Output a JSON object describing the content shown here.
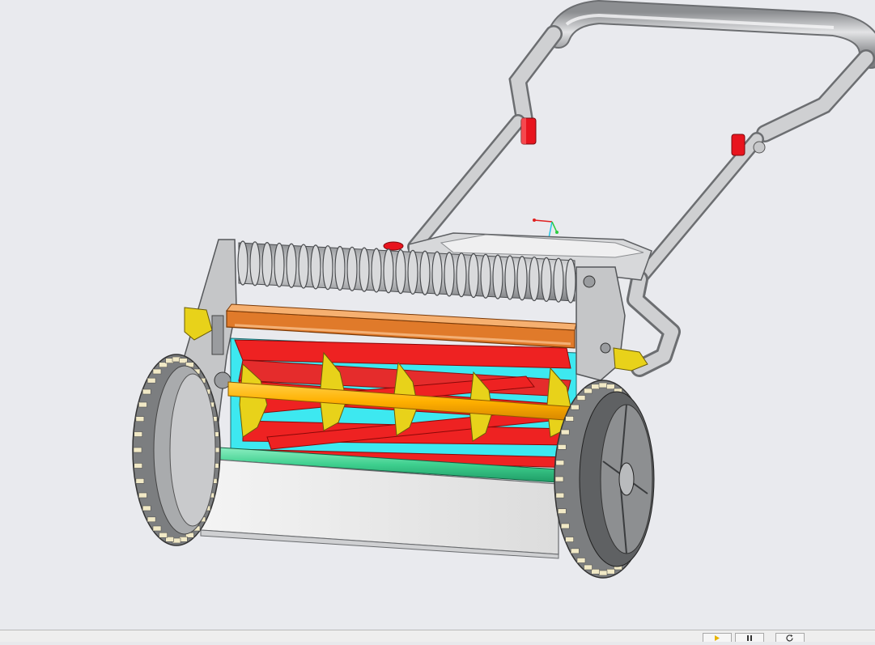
{
  "viewport": {
    "background": "#e9eaee",
    "model": "reel-lawn-mower-assembly"
  },
  "colors": {
    "steel": "#b8babd",
    "steel_dark": "#6e7073",
    "reel_blade": "#ee2222",
    "reel_disc": "#e8d21a",
    "reel_shaft": "#ffb000",
    "cavity": "#3de8f0",
    "bed_bar": "#e07a2a",
    "roller_bar": "#3ecf8e",
    "grip_red": "#e8141e",
    "tire": "#7c7e80",
    "tread": "#f1e9c6"
  },
  "statusbar": {
    "buttons": [
      {
        "icon": "play-icon"
      },
      {
        "icon": "pause-icon"
      },
      {
        "icon": "refresh-icon"
      }
    ]
  }
}
